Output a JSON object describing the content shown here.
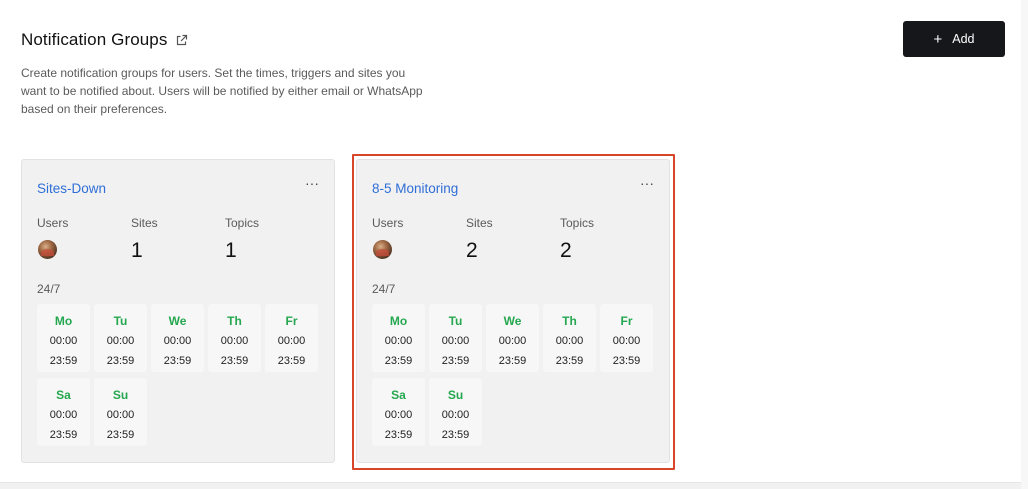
{
  "header": {
    "title": "Notification Groups",
    "description": "Create notification groups for users. Set the times, triggers and sites you want to be notified about. Users will be notified by either email or WhatsApp based on their preferences.",
    "add_label": "Add"
  },
  "labels": {
    "users": "Users",
    "sites": "Sites",
    "topics": "Topics",
    "menu": "···"
  },
  "groups": [
    {
      "name": "Sites-Down",
      "sites": "1",
      "topics": "1",
      "schedule": "24/7",
      "days": [
        {
          "day": "Mo",
          "start": "00:00",
          "end": "23:59"
        },
        {
          "day": "Tu",
          "start": "00:00",
          "end": "23:59"
        },
        {
          "day": "We",
          "start": "00:00",
          "end": "23:59"
        },
        {
          "day": "Th",
          "start": "00:00",
          "end": "23:59"
        },
        {
          "day": "Fr",
          "start": "00:00",
          "end": "23:59"
        },
        {
          "day": "Sa",
          "start": "00:00",
          "end": "23:59"
        },
        {
          "day": "Su",
          "start": "00:00",
          "end": "23:59"
        }
      ]
    },
    {
      "name": "8-5 Monitoring",
      "sites": "2",
      "topics": "2",
      "schedule": "24/7",
      "selected": true,
      "days": [
        {
          "day": "Mo",
          "start": "00:00",
          "end": "23:59"
        },
        {
          "day": "Tu",
          "start": "00:00",
          "end": "23:59"
        },
        {
          "day": "We",
          "start": "00:00",
          "end": "23:59"
        },
        {
          "day": "Th",
          "start": "00:00",
          "end": "23:59"
        },
        {
          "day": "Fr",
          "start": "00:00",
          "end": "23:59"
        },
        {
          "day": "Sa",
          "start": "00:00",
          "end": "23:59"
        },
        {
          "day": "Su",
          "start": "00:00",
          "end": "23:59"
        }
      ]
    }
  ],
  "colors": {
    "title_link": "#2f6fd6",
    "day_name": "#25a74f",
    "selection_outline": "#d8462a",
    "primary_button": "#16171b"
  }
}
